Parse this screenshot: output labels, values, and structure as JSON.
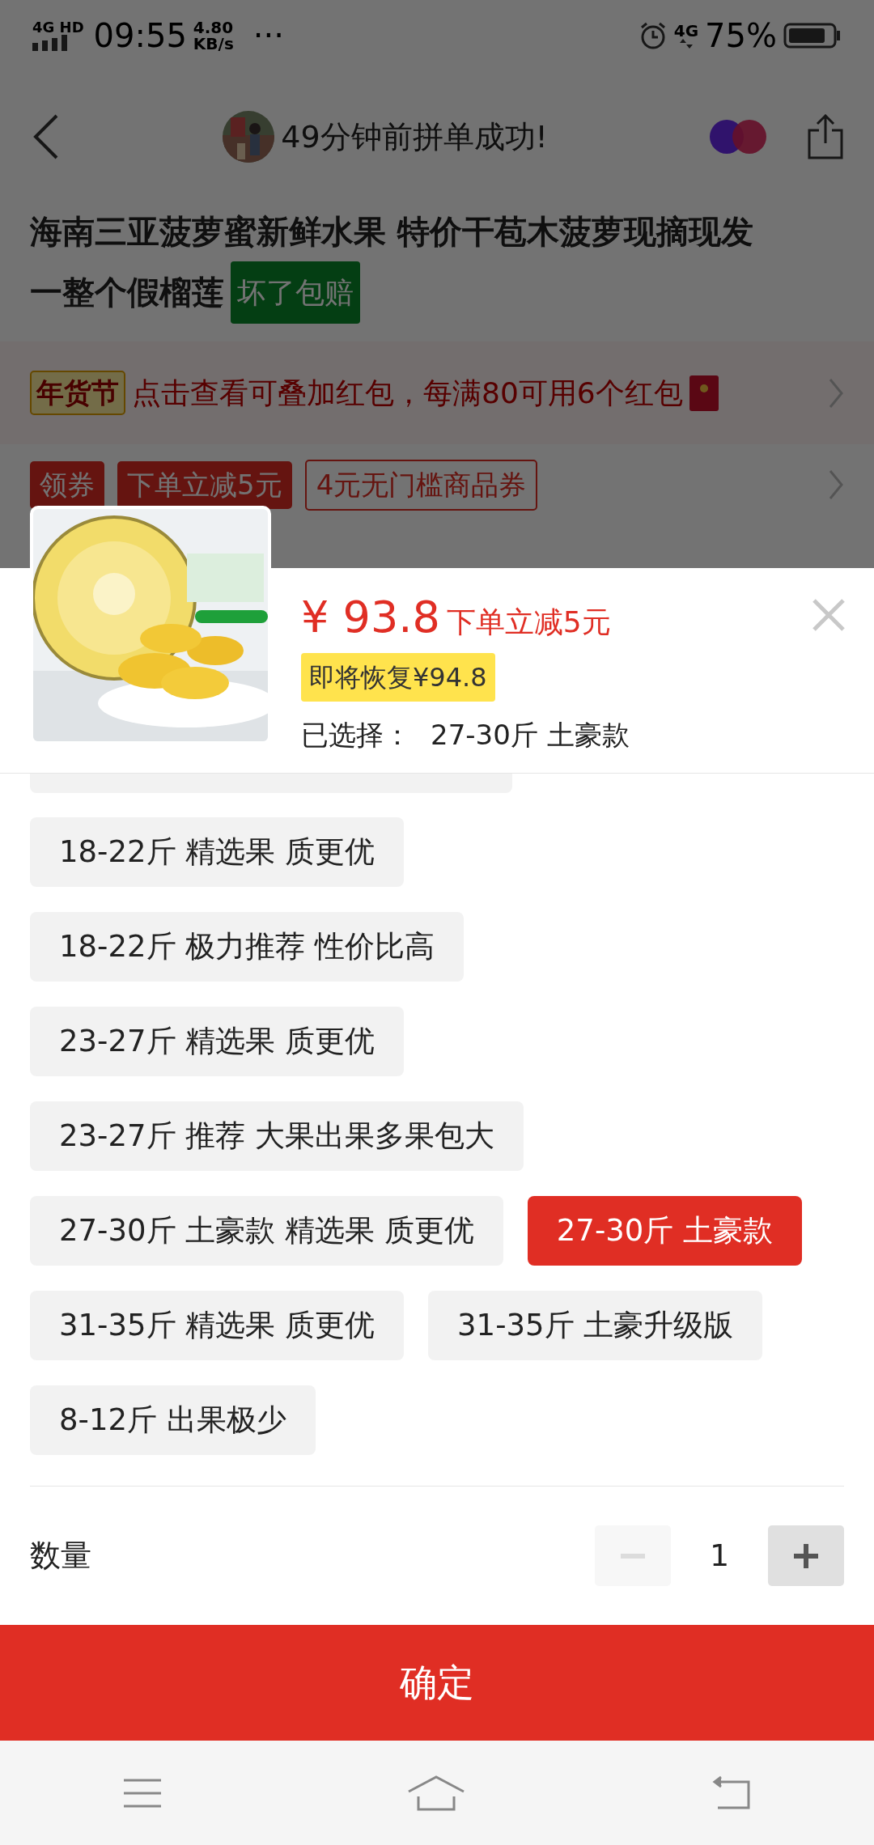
{
  "status_bar": {
    "network": "4G",
    "network_sup": "HD",
    "time": "09:55",
    "speed_value": "4.80",
    "speed_unit": "KB/s",
    "more": "···",
    "network_right": "4G",
    "battery": "75%"
  },
  "header": {
    "title": "49分钟前拼单成功!"
  },
  "product": {
    "title_lines": [
      "海南三亚菠萝蜜新鲜水果 特价干苞木菠萝现摘现发",
      "一整个假榴莲"
    ],
    "badge": "坏了包赔"
  },
  "promo": {
    "tag": "年货节",
    "text": "点击查看可叠加红包，每满80可用6个红包"
  },
  "coupons": [
    {
      "label": "领券",
      "kind": "filled"
    },
    {
      "label": "下单立减5元",
      "kind": "filled"
    },
    {
      "label": "4元无门槛商品券",
      "kind": "outline"
    }
  ],
  "sheet": {
    "currency": "¥",
    "price": "93.8",
    "discount": "下单立减5元",
    "restore": "即将恢复¥94.8",
    "selected_label": "已选择：",
    "selected_value": "27-30斤 土豪款"
  },
  "options": [
    {
      "label": "18-22斤 精选果 质更优",
      "selected": false
    },
    {
      "label": "18-22斤 极力推荐 性价比高",
      "selected": false
    },
    {
      "label": "23-27斤 精选果 质更优",
      "selected": false
    },
    {
      "label": "23-27斤 推荐 大果出果多果包大",
      "selected": false
    },
    {
      "label": "27-30斤 土豪款 精选果 质更优",
      "selected": false
    },
    {
      "label": "27-30斤 土豪款",
      "selected": true
    },
    {
      "label": "31-35斤 精选果 质更优",
      "selected": false
    },
    {
      "label": "31-35斤 土豪升级版",
      "selected": false
    },
    {
      "label": "8-12斤 出果极少",
      "selected": false
    }
  ],
  "quantity": {
    "label": "数量",
    "value": "1",
    "decrease_disabled": true
  },
  "confirm": "确定"
}
